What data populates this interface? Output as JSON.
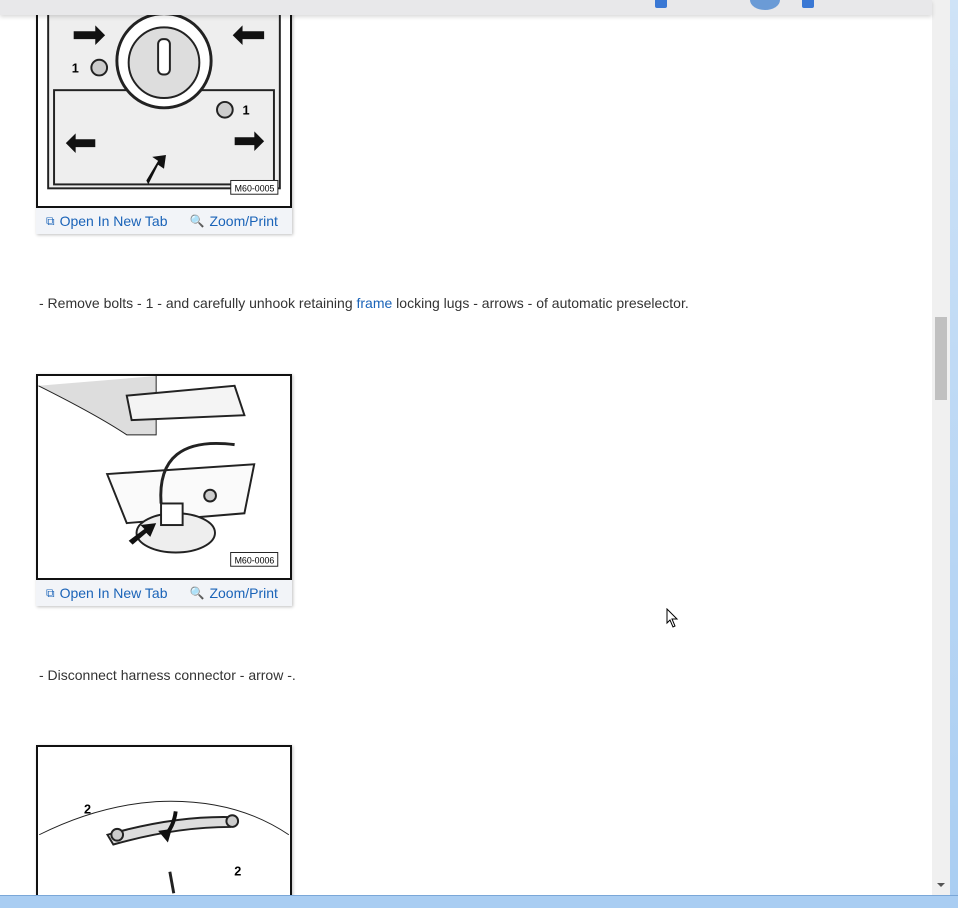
{
  "figures": [
    {
      "code": "M60-0005",
      "open_label": "Open In New Tab",
      "zoom_label": "Zoom/Print"
    },
    {
      "code": "M60-0006",
      "open_label": "Open In New Tab",
      "zoom_label": "Zoom/Print"
    },
    {
      "code": ""
    }
  ],
  "steps": [
    {
      "prefix": "-  Remove bolts - 1 - and carefully unhook retaining ",
      "link": "frame",
      "suffix": " locking lugs - arrows - of automatic preselector."
    },
    {
      "text": "-  Disconnect harness connector - arrow -."
    }
  ],
  "callouts": {
    "one": "1",
    "two": "2"
  },
  "colors": {
    "link": "#1a63b8",
    "text": "#333333",
    "scroll_thumb": "#c0c0c0"
  },
  "icons": {
    "open": "open-new-tab-icon",
    "zoom": "zoom-in-icon"
  }
}
